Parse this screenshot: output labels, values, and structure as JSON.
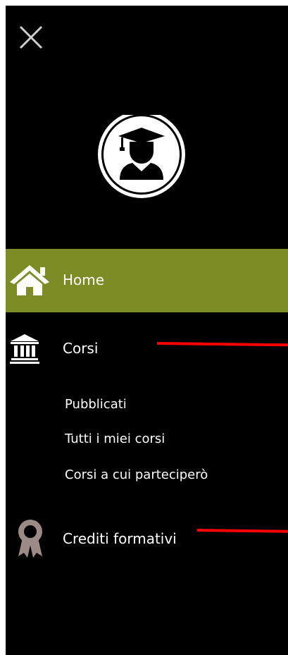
{
  "header": {
    "close_icon": "close-icon",
    "avatar_icon": "graduate-avatar-icon"
  },
  "nav": {
    "home": {
      "label": "Home",
      "icon": "home-icon",
      "active_color": "#7e8c25"
    },
    "corsi": {
      "label": "Corsi",
      "icon": "institution-icon",
      "submenu": [
        {
          "label": "Pubblicati"
        },
        {
          "label": "Tutti i miei corsi"
        },
        {
          "label": "Corsi a cui parteciperò"
        }
      ]
    },
    "crediti": {
      "label": "Crediti formativi",
      "icon": "award-badge-icon",
      "icon_color": "#9c8a86"
    }
  },
  "annotation_color": "#ff0000"
}
